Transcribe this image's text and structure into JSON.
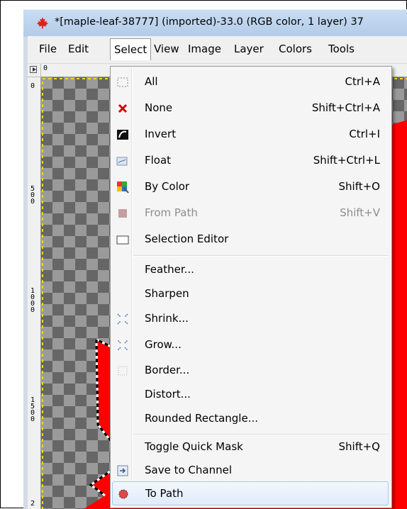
{
  "window": {
    "title": "*[maple-leaf-38777] (imported)-33.0 (RGB color, 1 layer) 37"
  },
  "menubar": {
    "items": [
      "File",
      "Edit",
      "Select",
      "View",
      "Image",
      "Layer",
      "Colors",
      "Tools"
    ],
    "active": "Select"
  },
  "rulers": {
    "h_label": "0",
    "v_labels": [
      "0",
      "500",
      "1000",
      "1500",
      "2"
    ]
  },
  "select_menu": {
    "items": [
      {
        "label": "All",
        "accel": "Ctrl+A",
        "icon": "select-all-icon"
      },
      {
        "label": "None",
        "accel": "Shift+Ctrl+A",
        "icon": "select-none-icon"
      },
      {
        "label": "Invert",
        "accel": "Ctrl+I",
        "icon": "invert-icon"
      },
      {
        "label": "Float",
        "accel": "Shift+Ctrl+L",
        "icon": "float-icon"
      },
      {
        "label": "By Color",
        "accel": "Shift+O",
        "icon": "by-color-icon"
      },
      {
        "label": "From Path",
        "accel": "Shift+V",
        "icon": "from-path-icon",
        "disabled": true
      },
      {
        "label": "Selection Editor",
        "accel": "",
        "icon": "selection-editor-icon"
      },
      {
        "label": "Feather...",
        "accel": "",
        "icon": ""
      },
      {
        "label": "Sharpen",
        "accel": "",
        "icon": ""
      },
      {
        "label": "Shrink...",
        "accel": "",
        "icon": "shrink-icon"
      },
      {
        "label": "Grow...",
        "accel": "",
        "icon": "grow-icon"
      },
      {
        "label": "Border...",
        "accel": "",
        "icon": "border-icon"
      },
      {
        "label": "Distort...",
        "accel": "",
        "icon": ""
      },
      {
        "label": "Rounded Rectangle...",
        "accel": "",
        "icon": ""
      },
      {
        "label": "Toggle Quick Mask",
        "accel": "Shift+Q",
        "icon": ""
      },
      {
        "label": "Save to Channel",
        "accel": "",
        "icon": "save-to-channel-icon"
      },
      {
        "label": "To Path",
        "accel": "",
        "icon": "to-path-icon",
        "highlighted": true
      }
    ]
  },
  "colors": {
    "leaf": "#ff0000",
    "menu_bg": "#f5f5f5",
    "highlight": "#e0ecfa",
    "titlebar": "#c0d6f0"
  }
}
